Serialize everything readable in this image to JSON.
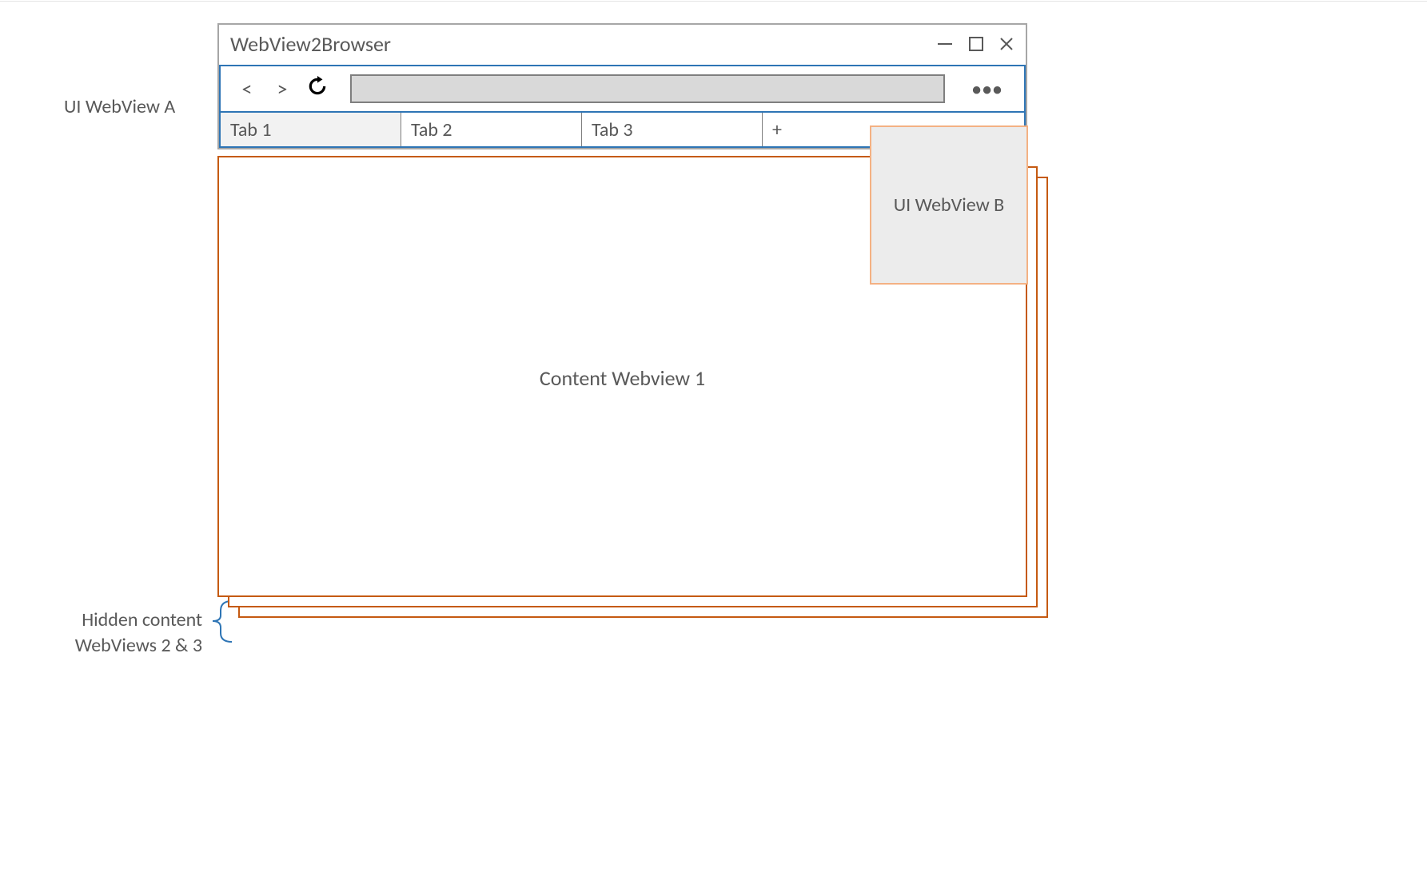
{
  "window": {
    "title": "WebView2Browser"
  },
  "toolbar": {
    "tabs": [
      {
        "label": "Tab 1"
      },
      {
        "label": "Tab 2"
      },
      {
        "label": "Tab 3"
      }
    ],
    "new_tab_label": "+"
  },
  "labels": {
    "ui_webview_a": "UI WebView A",
    "ui_webview_b": "UI WebView B",
    "content_webview_1": "Content Webview 1",
    "hidden_content_line1": "Hidden content",
    "hidden_content_line2": "WebViews 2 & 3"
  },
  "colors": {
    "window_border": "#a6a6a6",
    "ui_webview_border": "#2e75b5",
    "content_webview_border": "#c55a11",
    "panel_border": "#f4b183",
    "panel_fill": "#ececec",
    "addressbar_fill": "#d9d9d9",
    "tab_active_fill": "#f2f2f2"
  }
}
